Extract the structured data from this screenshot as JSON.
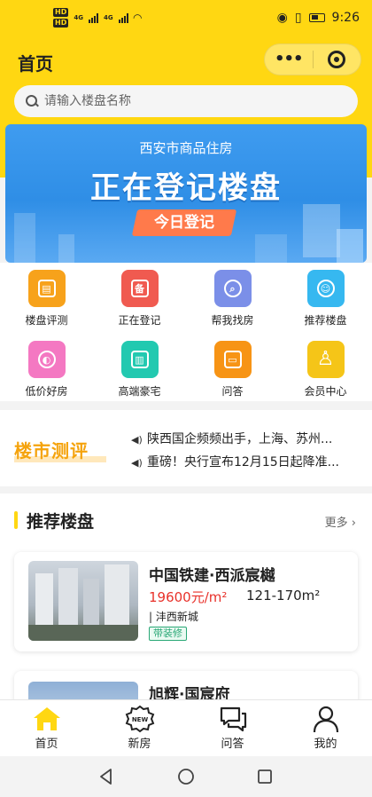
{
  "status_bar": {
    "badges": [
      "HD",
      "HD"
    ],
    "network": [
      "4G",
      "4G"
    ],
    "time": "9:26"
  },
  "header": {
    "title": "首页",
    "menu_dots": "•••"
  },
  "search": {
    "placeholder": "请输入楼盘名称"
  },
  "banner": {
    "subtitle": "西安市商品住房",
    "headline": "正在登记楼盘",
    "button": "今日登记"
  },
  "grid": [
    {
      "label": "楼盘评测",
      "icon": "building-report-icon",
      "color": "#f7a21b",
      "glyph": "▤"
    },
    {
      "label": "正在登记",
      "icon": "register-shield-icon",
      "color": "#f05a50",
      "glyph": "备"
    },
    {
      "label": "帮我找房",
      "icon": "find-house-icon",
      "color": "#7b8fe8",
      "glyph": "⌕"
    },
    {
      "label": "推荐楼盘",
      "icon": "recommend-icon",
      "color": "#36b8f0",
      "glyph": "☺"
    },
    {
      "label": "低价好房",
      "icon": "low-price-icon",
      "color": "#f478c2",
      "glyph": "◐"
    },
    {
      "label": "高端豪宅",
      "icon": "mansion-icon",
      "color": "#22c9b0",
      "glyph": "▥"
    },
    {
      "label": "问答",
      "icon": "qa-icon",
      "color": "#f79415",
      "glyph": "▭"
    },
    {
      "label": "会员中心",
      "icon": "member-icon",
      "color": "#f5c518",
      "glyph": "♙"
    }
  ],
  "news": {
    "title": "楼市测评",
    "items": [
      "陕西国企频频出手，上海、苏州...",
      "重磅！央行宣布12月15日起降准..."
    ]
  },
  "recommend": {
    "title": "推荐楼盘",
    "more": "更多 ›",
    "listings": [
      {
        "name": "中国铁建·西派宸樾",
        "price": "19600元/m²",
        "area": "121-170m²",
        "district": "| 沣西新城",
        "tag": "带装修"
      },
      {
        "name": "旭辉·国宸府"
      }
    ]
  },
  "tabbar": [
    {
      "label": "首页",
      "icon": "home-icon",
      "active": true
    },
    {
      "label": "新房",
      "icon": "new-badge-icon",
      "badge_text": "NEW"
    },
    {
      "label": "问答",
      "icon": "chat-icon"
    },
    {
      "label": "我的",
      "icon": "person-icon"
    }
  ],
  "colors": {
    "brand_yellow": "#ffd712",
    "price_red": "#e8312a",
    "tag_green": "#2aa876",
    "news_orange": "#f5a30c"
  }
}
